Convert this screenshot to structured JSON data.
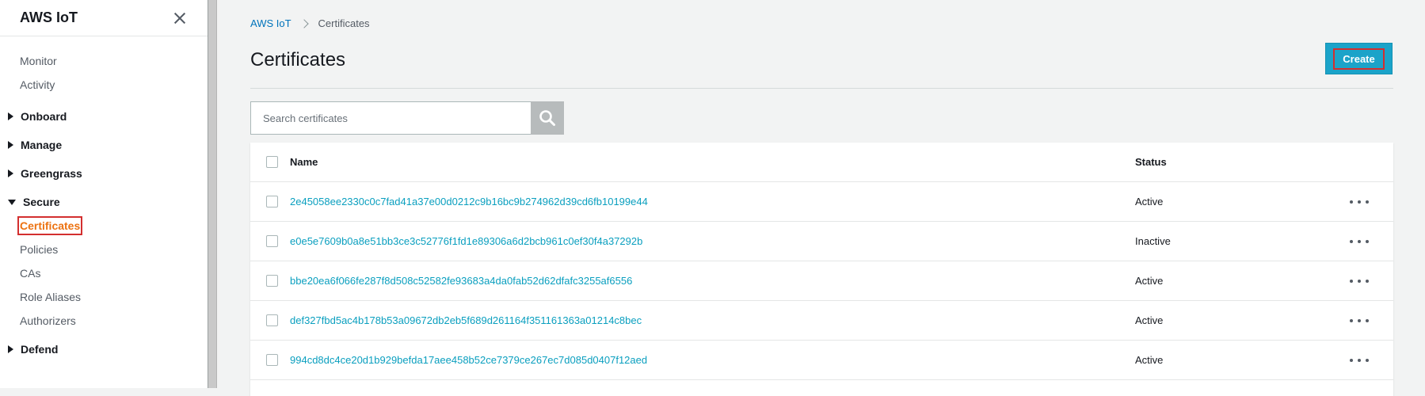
{
  "sidebar": {
    "title": "AWS IoT",
    "top_items": [
      {
        "label": "Monitor"
      },
      {
        "label": "Activity"
      }
    ],
    "sections": {
      "onboard": "Onboard",
      "manage": "Manage",
      "greengrass": "Greengrass",
      "secure": "Secure",
      "defend": "Defend"
    },
    "secure_items": [
      {
        "label": "Certificates",
        "active": true
      },
      {
        "label": "Policies"
      },
      {
        "label": "CAs"
      },
      {
        "label": "Role Aliases"
      },
      {
        "label": "Authorizers"
      }
    ]
  },
  "breadcrumb": {
    "root": "AWS IoT",
    "current": "Certificates"
  },
  "page": {
    "title": "Certificates",
    "create_label": "Create"
  },
  "search": {
    "placeholder": "Search certificates",
    "value": ""
  },
  "table": {
    "columns": {
      "name": "Name",
      "status": "Status"
    },
    "rows": [
      {
        "name": "2e45058ee2330c0c7fad41a37e00d0212c9b16bc9b274962d39cd6fb10199e44",
        "status": "Active"
      },
      {
        "name": "e0e5e7609b0a8e51bb3ce3c52776f1fd1e89306a6d2bcb961c0ef30f4a37292b",
        "status": "Inactive"
      },
      {
        "name": "bbe20ea6f066fe287f8d508c52582fe93683a4da0fab52d62dfafc3255af6556",
        "status": "Active"
      },
      {
        "name": "def327fbd5ac4b178b53a09672db2eb5f689d261164f351161363a01214c8bec",
        "status": "Active"
      },
      {
        "name": "994cd8dc4ce20d1b929befda17aee458b52ce7379ce267ec7d085d0407f12aed",
        "status": "Active"
      }
    ]
  },
  "colors": {
    "accent": "#1ba3c9",
    "link": "#0a9fbf",
    "active_nav": "#ec7211",
    "highlight_border": "#d32f2f"
  },
  "icons": {
    "close": "close-icon",
    "search": "search-icon",
    "more": "more-icon",
    "expand": "caret-right-icon",
    "collapse": "caret-down-icon"
  }
}
